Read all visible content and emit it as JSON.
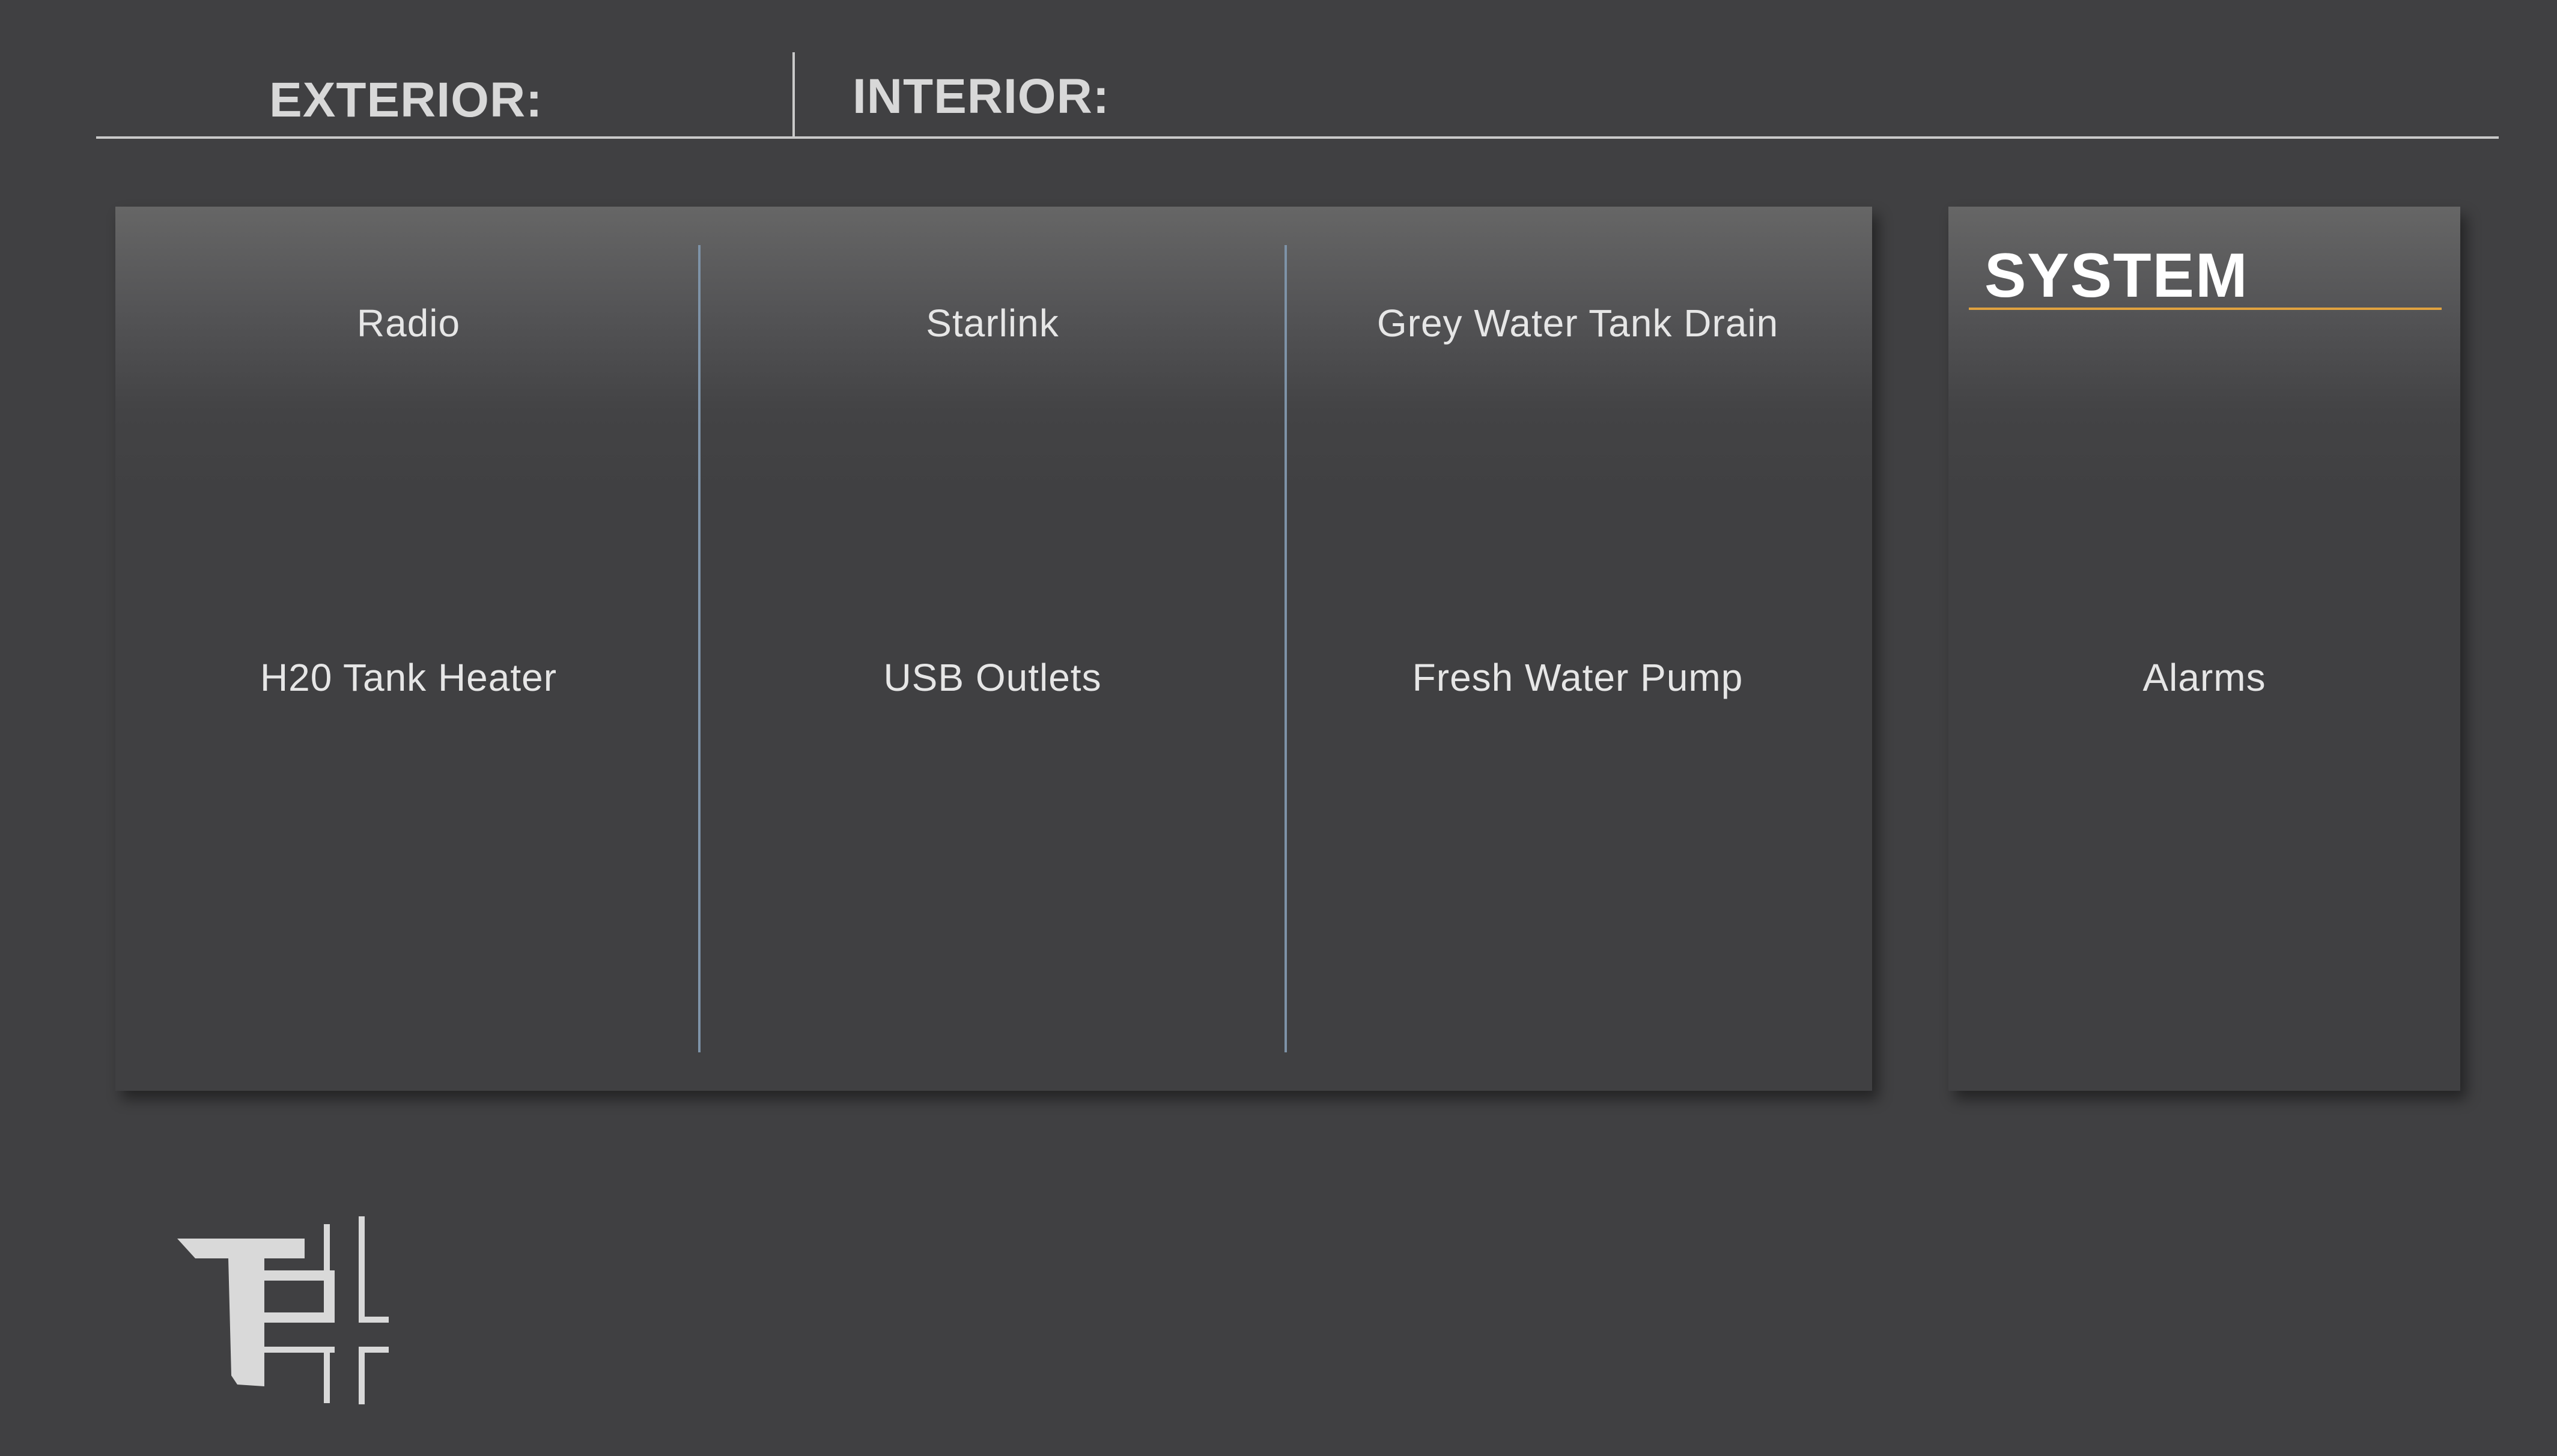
{
  "tabs": {
    "exterior_label": "EXTERIOR:",
    "interior_label": "INTERIOR:"
  },
  "controls": {
    "radio": "Radio",
    "starlink": "Starlink",
    "grey_water_tank_drain": "Grey Water Tank Drain",
    "h20_tank_heater": "H20 Tank Heater",
    "usb_outlets": "USB Outlets",
    "fresh_water_pump": "Fresh Water Pump"
  },
  "system": {
    "title": "SYSTEM",
    "alarms": "Alarms"
  },
  "colors": {
    "background": "#404042",
    "accent": "#e0a23f",
    "divider": "#7e93a8",
    "text": "#e6e6e6"
  },
  "icons": {
    "logo": "brand-logo-icon"
  }
}
